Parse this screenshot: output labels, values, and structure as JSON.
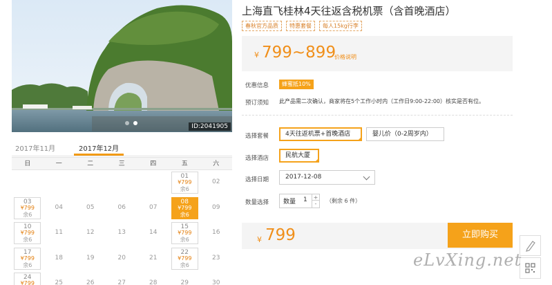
{
  "photo": {
    "id_label": "ID:2041905"
  },
  "calendar": {
    "tabs": [
      "2017年11月",
      "2017年12月"
    ],
    "weekdays": [
      "日",
      "一",
      "二",
      "三",
      "四",
      "五",
      "六"
    ],
    "days": [
      {
        "num": ""
      },
      {
        "num": ""
      },
      {
        "num": ""
      },
      {
        "num": ""
      },
      {
        "num": ""
      },
      {
        "num": "01",
        "price": "¥799",
        "stock": "余6"
      },
      {
        "num": "02"
      },
      {
        "num": "03",
        "price": "¥799",
        "stock": "余6"
      },
      {
        "num": "04"
      },
      {
        "num": "05"
      },
      {
        "num": "06"
      },
      {
        "num": "07"
      },
      {
        "num": "08",
        "price": "¥799",
        "stock": "余6",
        "selected": true
      },
      {
        "num": "09"
      },
      {
        "num": "10",
        "price": "¥799",
        "stock": "余6"
      },
      {
        "num": "11"
      },
      {
        "num": "12"
      },
      {
        "num": "13"
      },
      {
        "num": "14"
      },
      {
        "num": "15",
        "price": "¥799",
        "stock": "余6"
      },
      {
        "num": "16"
      },
      {
        "num": "17",
        "price": "¥799",
        "stock": "余6"
      },
      {
        "num": "18"
      },
      {
        "num": "19"
      },
      {
        "num": "20"
      },
      {
        "num": "21"
      },
      {
        "num": "22",
        "price": "¥799",
        "stock": "余6"
      },
      {
        "num": "23"
      },
      {
        "num": "24",
        "price": "¥799",
        "stock": "余6"
      },
      {
        "num": "25"
      },
      {
        "num": "26"
      },
      {
        "num": "27"
      },
      {
        "num": "28"
      },
      {
        "num": "29"
      },
      {
        "num": "30"
      }
    ]
  },
  "product": {
    "title": "上海直飞桂林4天往返含税机票（含首晚酒店）",
    "tags": [
      "春秋官方品质",
      "特惠套餐",
      "每人15kg行李"
    ],
    "price_currency": "¥",
    "price_range": "799~899",
    "price_note": "价格说明"
  },
  "info": {
    "discount_label": "优惠信息",
    "discount_value": "蜂蜜抵10%",
    "notice_label": "预订须知",
    "notice_text": "此产品需二次确认，商家将在5个工作小时内（工作日9:00-22:00）核实是否有位。"
  },
  "options": {
    "package_label": "选择套餐",
    "packages": [
      "4天往返机票+首晚酒店",
      "婴儿价（0-2周岁内）"
    ],
    "hotel_label": "选择酒店",
    "hotel": "民航大厦",
    "date_label": "选择日期",
    "date_value": "2017-12-08",
    "qty_label": "数量选择",
    "qty_field_label": "数量",
    "qty_value": "1",
    "qty_plus": "+",
    "qty_minus": "-",
    "stock_note": "（剩余 6 件）"
  },
  "checkout": {
    "currency": "¥",
    "total": "799",
    "buy_label": "立即购买"
  },
  "watermark": "eLvXing.net"
}
